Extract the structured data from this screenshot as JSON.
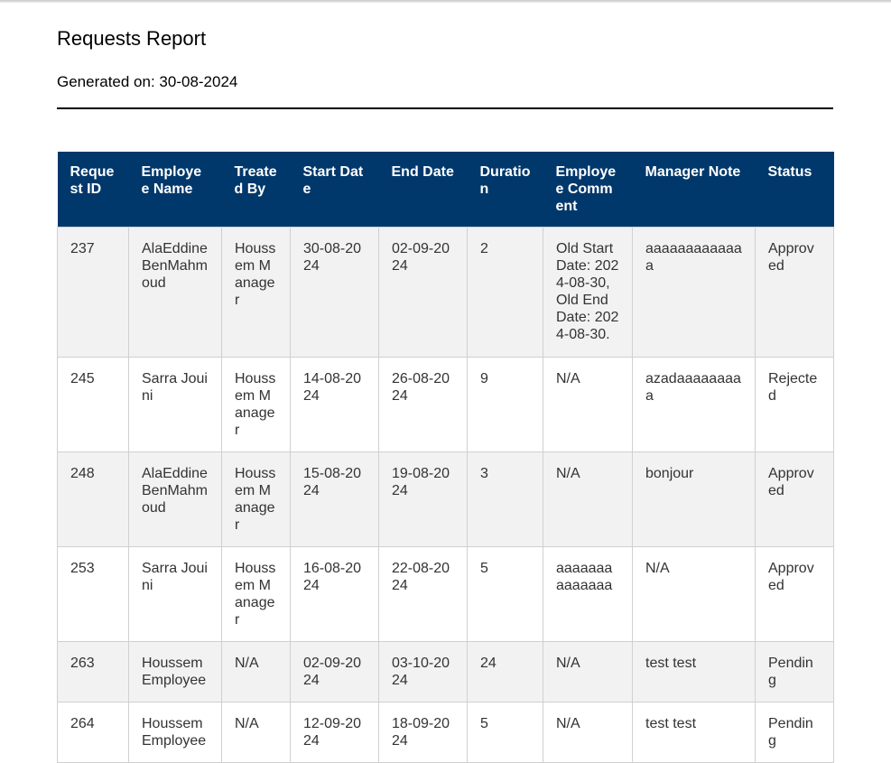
{
  "report": {
    "title": "Requests Report",
    "generated_label": "Generated on: 30-08-2024"
  },
  "table": {
    "columns": [
      "Request ID",
      "Employee Name",
      "Treated By",
      "Start Date",
      "End Date",
      "Duration",
      "Employee Comment",
      "Manager Note",
      "Status"
    ],
    "rows": [
      [
        "237",
        "AlaEddine BenMahmoud",
        "Houssem Manager",
        "30-08-2024",
        "02-09-2024",
        "2",
        "Old Start Date: 2024-08-30, Old End Date: 2024-08-30.",
        "aaaaaaaaaaaaa",
        "Approved"
      ],
      [
        "245",
        "Sarra Jouini",
        "Houssem Manager",
        "14-08-2024",
        "26-08-2024",
        "9",
        "N/A",
        "azadaaaaaaaaa",
        "Rejected"
      ],
      [
        "248",
        "AlaEddine BenMahmoud",
        "Houssem Manager",
        "15-08-2024",
        "19-08-2024",
        "3",
        "N/A",
        "bonjour",
        "Approved"
      ],
      [
        "253",
        "Sarra Jouini",
        "Houssem Manager",
        "16-08-2024",
        "22-08-2024",
        "5",
        "aaaaaaaaaaaaaa",
        "N/A",
        "Approved"
      ],
      [
        "263",
        "Houssem Employee",
        "N/A",
        "02-09-2024",
        "03-10-2024",
        "24",
        "N/A",
        "test test",
        "Pending"
      ],
      [
        "264",
        "Houssem Employee",
        "N/A",
        "12-09-2024",
        "18-09-2024",
        "5",
        "N/A",
        "test test",
        "Pending"
      ]
    ]
  },
  "colors": {
    "header_bg": "#01386b",
    "header_text": "#ffffff",
    "row_alt_bg": "#f2f2f2"
  }
}
